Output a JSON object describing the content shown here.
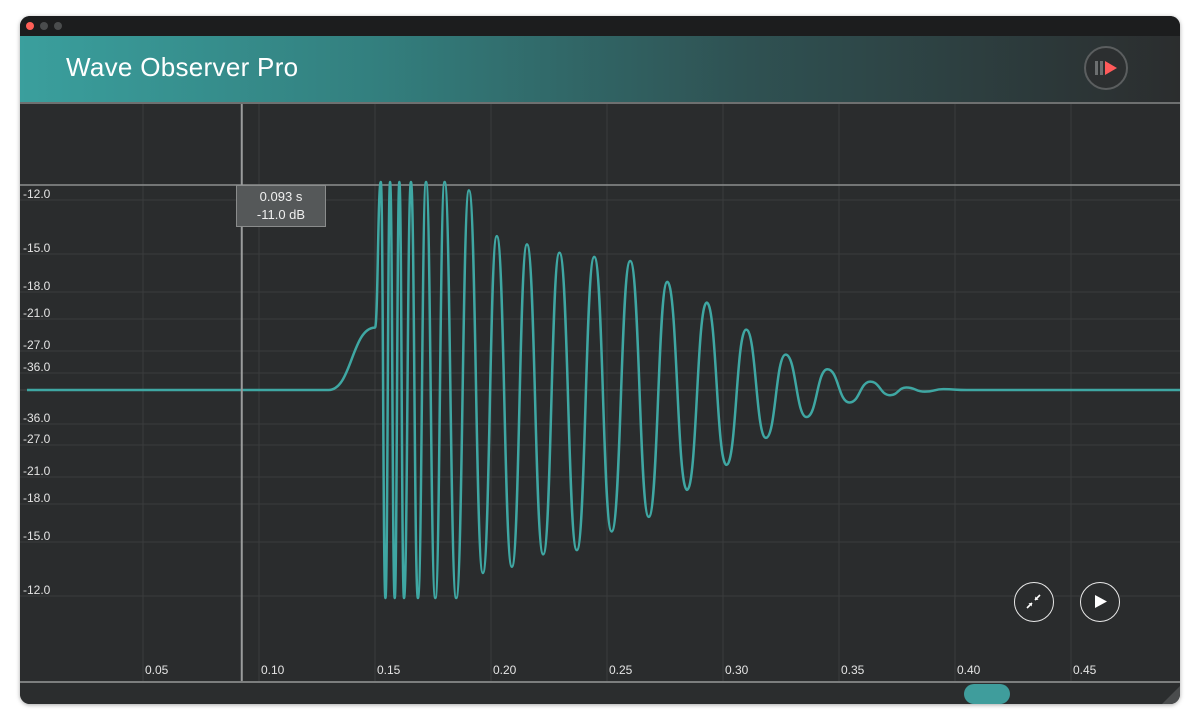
{
  "window": {
    "title": "Wave Observer Pro"
  },
  "header": {
    "record_button_icon": "pause-record-icon"
  },
  "cursor": {
    "time": "0.093 s",
    "level": "-11.0 dB"
  },
  "controls": {
    "collapse_icon": "collapse-arrows-icon",
    "play_icon": "play-icon"
  },
  "chart_data": {
    "type": "line",
    "y_tick_labels_upper": [
      "-12.0",
      "-15.0",
      "-18.0",
      "-21.0",
      "-27.0",
      "-36.0"
    ],
    "y_tick_labels_lower": [
      "-36.0",
      "-27.0",
      "-21.0",
      "-18.0",
      "-15.0",
      "-12.0"
    ],
    "x_ticks": [
      "0.05",
      "0.10",
      "0.15",
      "0.20",
      "0.25",
      "0.30",
      "0.35",
      "0.40",
      "0.45"
    ],
    "x_range": [
      0.0,
      0.5
    ],
    "cursor_x": 0.093,
    "series": [
      {
        "color": "#3fa7a3",
        "x": [
          0.0,
          0.13,
          0.15,
          0.1525,
          0.1545,
          0.1565,
          0.1585,
          0.1605,
          0.1625,
          0.1655,
          0.1685,
          0.172,
          0.176,
          0.18,
          0.185,
          0.1905,
          0.1965,
          0.2025,
          0.209,
          0.2155,
          0.2225,
          0.2295,
          0.237,
          0.2445,
          0.252,
          0.26,
          0.268,
          0.276,
          0.2845,
          0.293,
          0.3015,
          0.31,
          0.3185,
          0.327,
          0.336,
          0.345,
          0.3545,
          0.3635,
          0.372,
          0.379,
          0.387,
          0.395,
          0.405,
          0.42,
          0.5
        ],
        "y": [
          0.0,
          0.0,
          0.3,
          1.0,
          -1.0,
          1.0,
          -1.0,
          1.0,
          -1.0,
          1.0,
          -1.0,
          1.0,
          -1.0,
          1.0,
          -1.0,
          0.96,
          -0.88,
          0.74,
          -0.85,
          0.7,
          -0.79,
          0.66,
          -0.77,
          0.64,
          -0.68,
          0.62,
          -0.61,
          0.52,
          -0.48,
          0.42,
          -0.36,
          0.29,
          -0.23,
          0.17,
          -0.13,
          0.1,
          -0.06,
          0.04,
          -0.025,
          0.012,
          -0.008,
          0.004,
          0.0,
          0.0,
          0.0
        ]
      }
    ]
  }
}
